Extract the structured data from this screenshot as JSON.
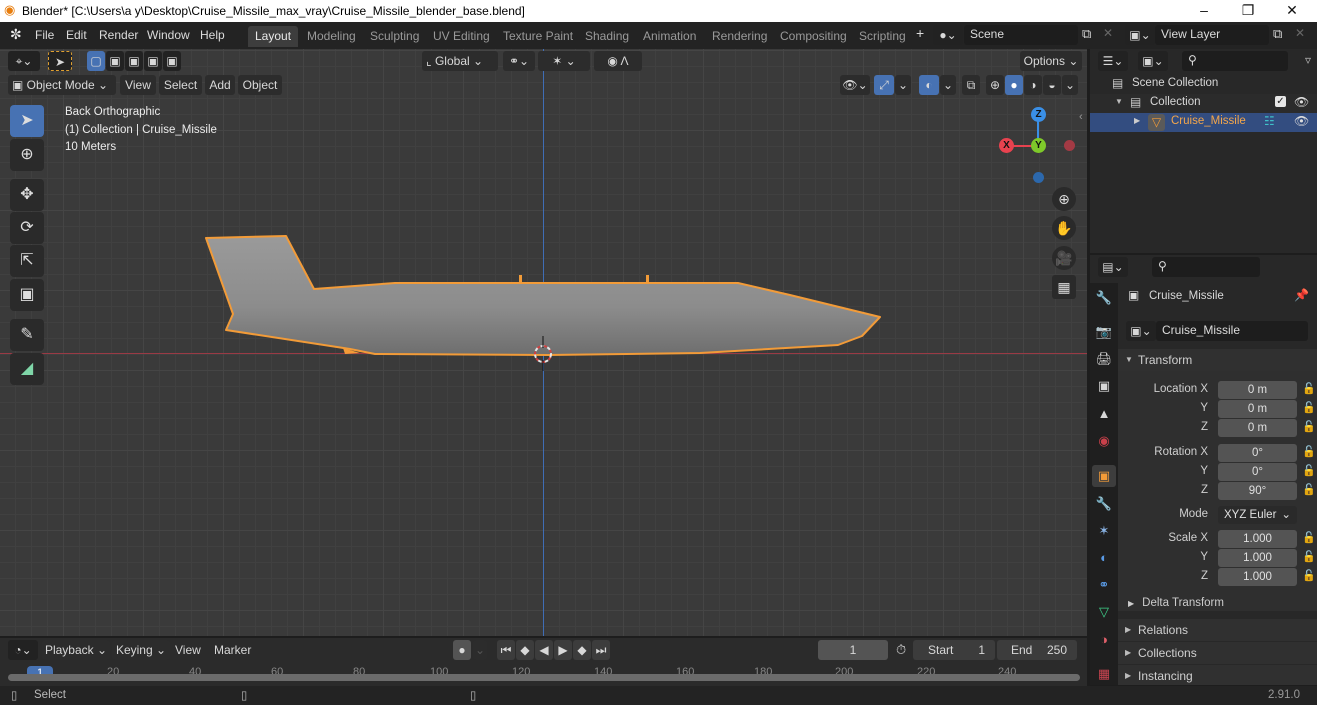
{
  "window": {
    "title": "Blender* [C:\\Users\\a y\\Desktop\\Cruise_Missile_max_vray\\Cruise_Missile_blender_base.blend]",
    "controls": [
      "minimize",
      "restore",
      "close"
    ]
  },
  "menu": {
    "items": [
      "File",
      "Edit",
      "Render",
      "Window",
      "Help"
    ]
  },
  "workspaces": {
    "tabs": [
      "Layout",
      "Modeling",
      "Sculpting",
      "UV Editing",
      "Texture Paint",
      "Shading",
      "Animation",
      "Rendering",
      "Compositing",
      "Scripting"
    ],
    "active": "Layout",
    "add_label": "+"
  },
  "scene": {
    "name": "Scene"
  },
  "view_layer": {
    "name": "View Layer"
  },
  "viewport_header": {
    "transform_orientation": "Global",
    "options_label": "Options",
    "mode": "Object Mode",
    "menus": [
      "View",
      "Select",
      "Add",
      "Object"
    ]
  },
  "viewport_overlay_text": {
    "view_name": "Back Orthographic",
    "collection_info": "(1) Collection | Cruise_Missile",
    "grid_scale": "10 Meters"
  },
  "gizmo": {
    "axes": [
      "Z",
      "X",
      "Y"
    ]
  },
  "outliner": {
    "search_placeholder": "",
    "items": [
      {
        "label": "Scene Collection",
        "level": 0
      },
      {
        "label": "Collection",
        "level": 1
      },
      {
        "label": "Cruise_Missile",
        "level": 2,
        "selected": true
      }
    ]
  },
  "properties": {
    "object_name": "Cruise_Missile",
    "datablock_name": "Cruise_Missile",
    "transform_panel": "Transform",
    "location": {
      "label": "Location X",
      "x": "0 m",
      "y": "0 m",
      "z": "0 m"
    },
    "rotation": {
      "label": "Rotation X",
      "x": "0°",
      "y": "0°",
      "z": "90°"
    },
    "mode_label": "Mode",
    "mode_value": "XYZ Euler",
    "scale": {
      "label": "Scale X",
      "x": "1.000",
      "y": "1.000",
      "z": "1.000"
    },
    "axis_labels": [
      "Y",
      "Z"
    ],
    "subpanels": [
      "Delta Transform",
      "Relations",
      "Collections",
      "Instancing"
    ]
  },
  "timeline": {
    "menus": [
      "Playback",
      "Keying",
      "View",
      "Marker"
    ],
    "current_frame": "1",
    "start_label": "Start",
    "start": "1",
    "end_label": "End",
    "end": "250",
    "ruler": [
      "1",
      "20",
      "40",
      "60",
      "80",
      "100",
      "120",
      "140",
      "160",
      "180",
      "200",
      "220",
      "240"
    ]
  },
  "statusbar": {
    "left_hint": "Select",
    "version": "2.91.0"
  },
  "colors": {
    "accent_blue": "#4772b3",
    "selection_orange": "#f29b38",
    "axis_x": "#e8424f",
    "axis_y": "#7ec92a",
    "axis_z": "#3a8fe6"
  }
}
